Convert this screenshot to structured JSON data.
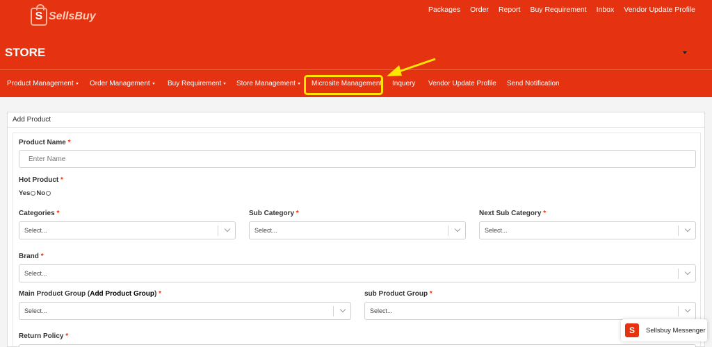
{
  "brand": {
    "logo_letter": "S",
    "logo_text": "SellsBuy"
  },
  "top_links": [
    "Packages",
    "Order",
    "Report",
    "Buy Requirement",
    "Inbox",
    "Vendor Update Profile"
  ],
  "store_title": "STORE",
  "nav": {
    "product_management": "Product Management",
    "order_management": "Order Management",
    "buy_requirement": "Buy Requirement",
    "store_management": "Store Management",
    "microsite_management": "Microsite Management",
    "inquery": "Inquery",
    "vendor_update_profile": "Vendor Update Profile",
    "send_notification": "Send Notification"
  },
  "form": {
    "card_title": "Add Product",
    "product_name_label": "Product Name",
    "product_name_placeholder": "Enter Name",
    "hot_product_label": "Hot Product",
    "yes_label": "Yes",
    "no_label": "No",
    "categories_label": "Categories",
    "sub_category_label": "Sub Category",
    "next_sub_category_label": "Next Sub Category",
    "brand_label": "Brand",
    "main_group_label_pre": "Main Product Group (",
    "main_group_label_link": "Add Product Group",
    "main_group_label_post": ")",
    "sub_group_label": "sub Product Group",
    "return_policy_label": "Return Policy",
    "select_placeholder": "Select...",
    "required_mark": "*"
  },
  "messenger": {
    "icon_letter": "S",
    "label": "Sellsbuy Messenger"
  },
  "colors": {
    "brand": "#e53210",
    "highlight": "#ffe600"
  }
}
